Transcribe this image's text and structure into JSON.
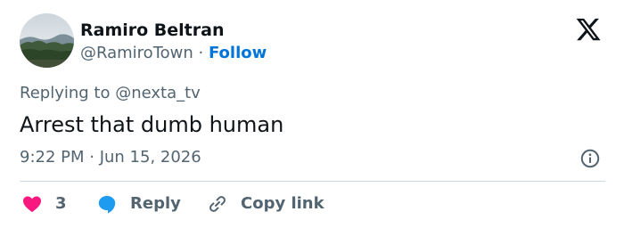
{
  "author": {
    "name": "Ramiro Beltran",
    "handle": "@RamiroTown",
    "separator": "·",
    "follow_label": "Follow"
  },
  "brand_icon": "x-logo-icon",
  "reply_context": {
    "text": "Replying to @nexta_tv"
  },
  "tweet": {
    "text": "Arrest that dumb human",
    "timestamp": "9:22 PM · Jun 15, 2026"
  },
  "actions": {
    "like_count": "3",
    "reply_label": "Reply",
    "copy_label": "Copy link"
  },
  "colors": {
    "follow": "#0074d9",
    "heart": "#f91880",
    "reply_bubble": "#1d9bf0",
    "secondary_text": "#536471",
    "primary_text": "#0f1419"
  },
  "icons": {
    "like": "heart-icon",
    "reply": "speech-bubble-icon",
    "copy": "link-icon",
    "info": "info-icon"
  }
}
